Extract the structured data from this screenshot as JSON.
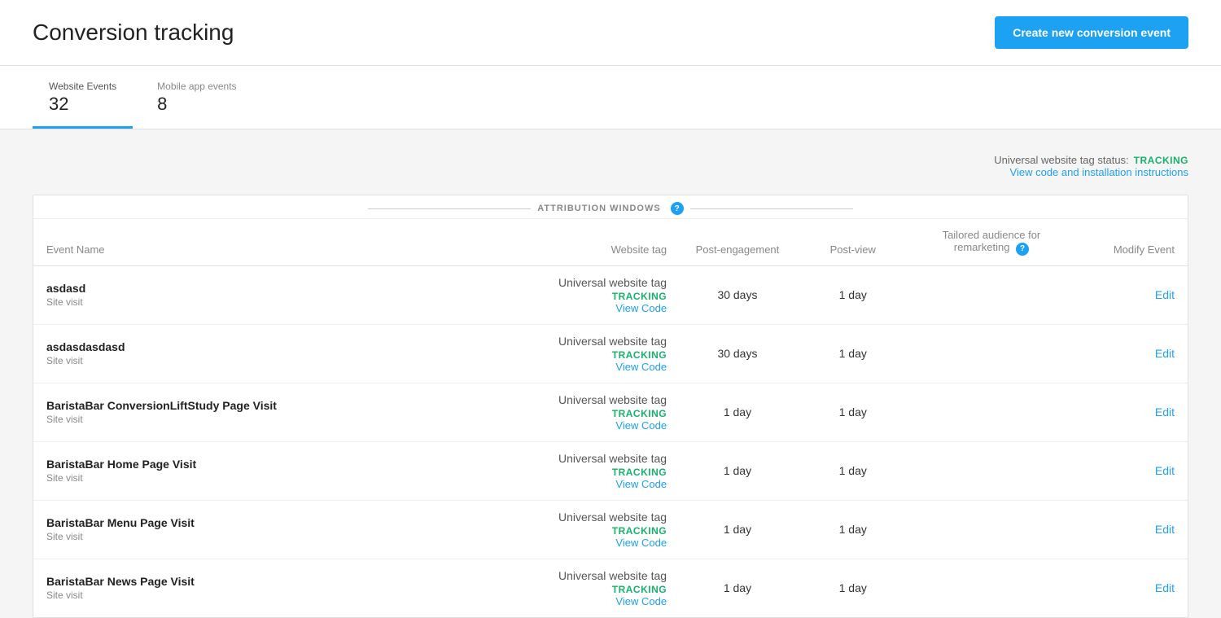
{
  "header": {
    "title": "Conversion tracking",
    "create_button_label": "Create new conversion event"
  },
  "tabs": [
    {
      "id": "website",
      "label": "Website Events",
      "count": "32",
      "active": true
    },
    {
      "id": "mobile",
      "label": "Mobile app events",
      "count": "8",
      "active": false
    }
  ],
  "tag_status": {
    "label": "Universal website tag status:",
    "status": "TRACKING",
    "view_code_label": "View code and installation instructions"
  },
  "attribution_windows_label": "ATTRIBUTION WINDOWS",
  "table": {
    "columns": {
      "event_name": "Event Name",
      "website_tag": "Website tag",
      "post_engagement": "Post-engagement",
      "post_view": "Post-view",
      "tailored_audience": "Tailored audience for remarketing",
      "modify_event": "Modify Event"
    },
    "rows": [
      {
        "name": "asdasd",
        "type": "Site visit",
        "tag": "Universal website tag",
        "tracking": "TRACKING",
        "view_code": "View Code",
        "post_engagement": "30 days",
        "post_view": "1 day",
        "tailored_audience": "",
        "edit": "Edit"
      },
      {
        "name": "asdasdasdasd",
        "type": "Site visit",
        "tag": "Universal website tag",
        "tracking": "TRACKING",
        "view_code": "View Code",
        "post_engagement": "30 days",
        "post_view": "1 day",
        "tailored_audience": "",
        "edit": "Edit"
      },
      {
        "name": "BaristaBar ConversionLiftStudy Page Visit",
        "type": "Site visit",
        "tag": "Universal website tag",
        "tracking": "TRACKING",
        "view_code": "View Code",
        "post_engagement": "1 day",
        "post_view": "1 day",
        "tailored_audience": "",
        "edit": "Edit"
      },
      {
        "name": "BaristaBar Home Page Visit",
        "type": "Site visit",
        "tag": "Universal website tag",
        "tracking": "TRACKING",
        "view_code": "View Code",
        "post_engagement": "1 day",
        "post_view": "1 day",
        "tailored_audience": "",
        "edit": "Edit"
      },
      {
        "name": "BaristaBar Menu Page Visit",
        "type": "Site visit",
        "tag": "Universal website tag",
        "tracking": "TRACKING",
        "view_code": "View Code",
        "post_engagement": "1 day",
        "post_view": "1 day",
        "tailored_audience": "",
        "edit": "Edit"
      },
      {
        "name": "BaristaBar News Page Visit",
        "type": "Site visit",
        "tag": "Universal website tag",
        "tracking": "TRACKING",
        "view_code": "View Code",
        "post_engagement": "1 day",
        "post_view": "1 day",
        "tailored_audience": "",
        "edit": "Edit"
      }
    ]
  },
  "colors": {
    "tracking": "#17b26a",
    "link": "#1da1f2",
    "accent": "#1da1f2"
  }
}
